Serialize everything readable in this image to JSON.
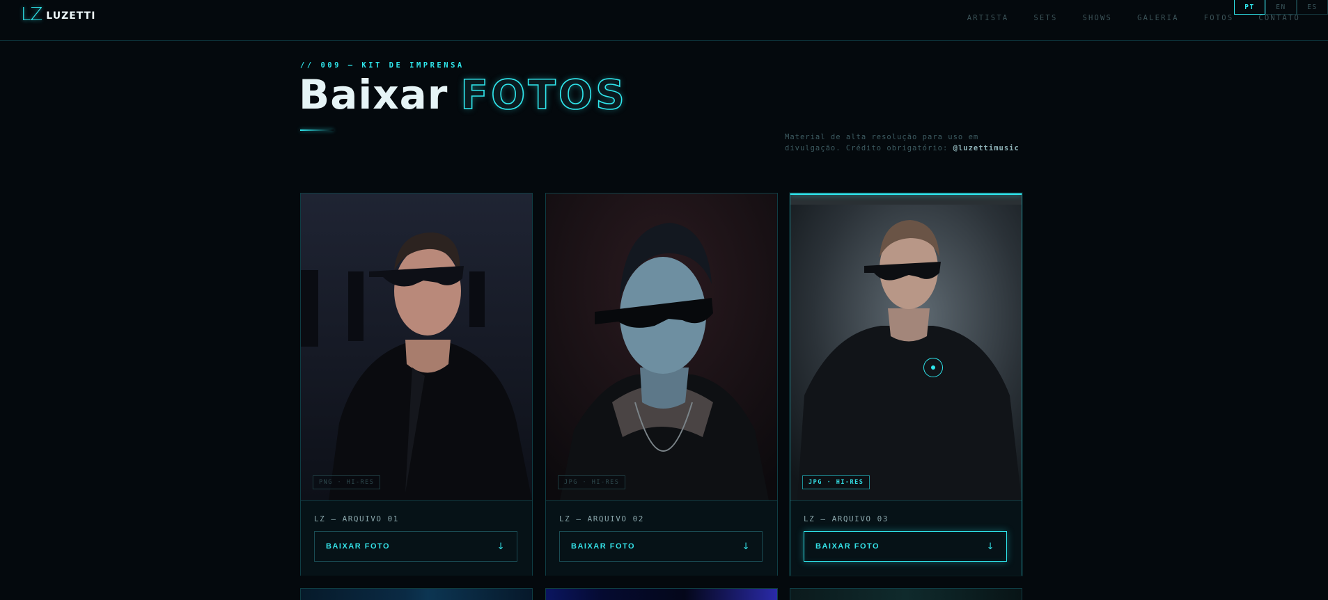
{
  "header": {
    "logo_mark": "LZ",
    "logo_text": "LUZETTI",
    "nav": [
      "ARTISTA",
      "SETS",
      "SHOWS",
      "GALERIA",
      "FOTOS",
      "CONTATO"
    ],
    "languages": [
      {
        "code": "PT",
        "active": true
      },
      {
        "code": "EN",
        "active": false
      },
      {
        "code": "ES",
        "active": false
      }
    ]
  },
  "hero": {
    "eyebrow": "// 009 — KIT DE IMPRENSA",
    "title_solid": "Baixar",
    "title_outline": "FOTOS",
    "description": "Material de alta resolução para uso em divulgação. Crédito obrigatório: ",
    "credit_handle": "@luzettimusic"
  },
  "cards": [
    {
      "badge": "PNG · HI-RES",
      "title": "LZ — ARQUIVO 01",
      "button": "BAIXAR FOTO",
      "arrow": "↓"
    },
    {
      "badge": "JPG · HI-RES",
      "title": "LZ — ARQUIVO 02",
      "button": "BAIXAR FOTO",
      "arrow": "↓"
    },
    {
      "badge": "JPG · HI-RES",
      "title": "LZ — ARQUIVO 03",
      "button": "BAIXAR FOTO",
      "arrow": "↓",
      "active": true
    }
  ],
  "colors": {
    "accent": "#2fe6ec",
    "background": "#04090d",
    "border": "#0f3d44"
  }
}
